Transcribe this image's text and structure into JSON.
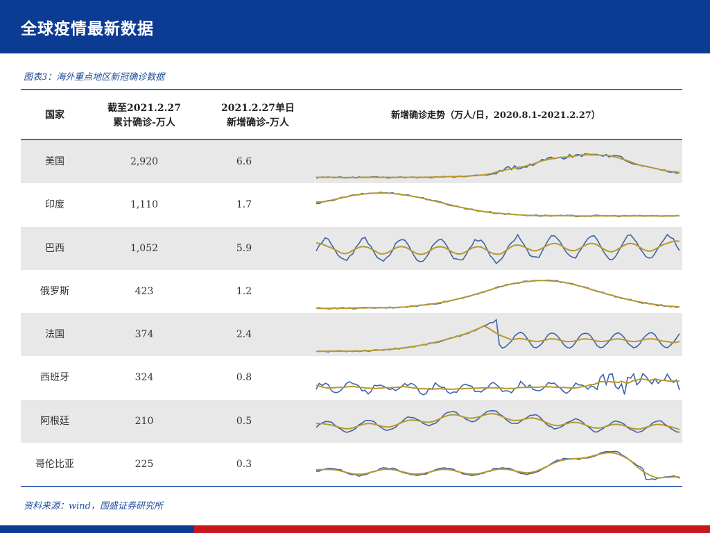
{
  "header": {
    "title": "全球疫情最新数据"
  },
  "figure": {
    "caption": "图表3：海外重点地区新冠确诊数据"
  },
  "table": {
    "columns": {
      "country": "国家",
      "cumulative_line1": "截至2021.2.27",
      "cumulative_line2": "累计确诊-万人",
      "new_line1": "2021.2.27单日",
      "new_line2": "新增确诊-万人",
      "trend": "新增确诊走势（万人/日，2020.8.1-2021.2.27）"
    },
    "rows": [
      {
        "country": "美国",
        "cumulative": "2,920",
        "new": "6.6"
      },
      {
        "country": "印度",
        "cumulative": "1,110",
        "new": "1.7"
      },
      {
        "country": "巴西",
        "cumulative": "1,052",
        "new": "5.9"
      },
      {
        "country": "俄罗斯",
        "cumulative": "423",
        "new": "1.2"
      },
      {
        "country": "法国",
        "cumulative": "374",
        "new": "2.4"
      },
      {
        "country": "西班牙",
        "cumulative": "324",
        "new": "0.8"
      },
      {
        "country": "阿根廷",
        "cumulative": "210",
        "new": "0.5"
      },
      {
        "country": "哥伦比亚",
        "cumulative": "225",
        "new": "0.3"
      }
    ]
  },
  "source": {
    "text": "资料来源：wind，国盛证券研究所"
  },
  "colors": {
    "header_bg": "#0c3b94",
    "rule": "#3e6ebb",
    "line_gold": "#b8982e",
    "line_blue": "#3b64a8",
    "stripe": "#e8e8e8",
    "bottom_red": "#c8161d"
  }
}
